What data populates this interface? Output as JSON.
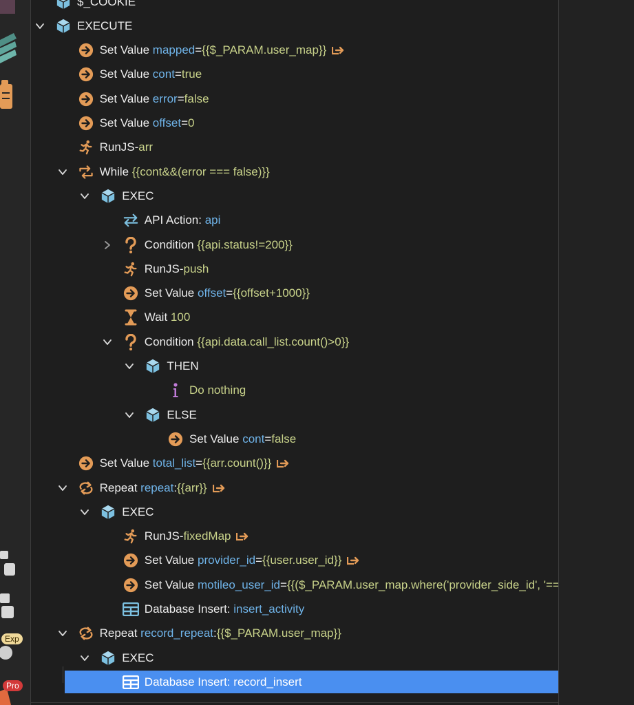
{
  "sidebar": {
    "badge_exp": "Exp",
    "badge_pro": "Pro"
  },
  "rows": [
    {
      "id": "cookie",
      "kw": "$_COOKIE"
    },
    {
      "id": "execute",
      "kw": "EXECUTE"
    },
    {
      "id": "sv-mapped",
      "kw": "Set Value",
      "var": "mapped",
      "sep": " = ",
      "val": "{{$_PARAM.user_map}}"
    },
    {
      "id": "sv-cont",
      "kw": "Set Value",
      "var": "cont",
      "sep": " = ",
      "val": "true"
    },
    {
      "id": "sv-error",
      "kw": "Set Value",
      "var": "error",
      "sep": " = ",
      "val": "false"
    },
    {
      "id": "sv-offset",
      "kw": "Set Value",
      "var": "offset",
      "sep": " = ",
      "val": "0"
    },
    {
      "id": "runjs-arr",
      "kw": "RunJS",
      "sep": " - ",
      "val": "arr"
    },
    {
      "id": "while",
      "kw": "While",
      "val": "{{cont&&(error === false)}}"
    },
    {
      "id": "exec-1",
      "kw": "EXEC"
    },
    {
      "id": "api",
      "kw": "API Action:",
      "var": "api"
    },
    {
      "id": "cond-1",
      "kw": "Condition",
      "val": "{{api.status!=200}}"
    },
    {
      "id": "runjs-push",
      "kw": "RunJS",
      "sep": " - ",
      "val": "push"
    },
    {
      "id": "sv-offset2",
      "kw": "Set Value",
      "var": "offset",
      "sep": " = ",
      "val": "{{offset+1000}}"
    },
    {
      "id": "wait",
      "kw": "Wait",
      "val": "100"
    },
    {
      "id": "cond-2",
      "kw": "Condition",
      "val": "{{api.data.call_list.count()>0}}"
    },
    {
      "id": "then",
      "kw": "THEN"
    },
    {
      "id": "do-nothing",
      "val": "Do nothing"
    },
    {
      "id": "else",
      "kw": "ELSE"
    },
    {
      "id": "sv-cont2",
      "kw": "Set Value",
      "var": "cont",
      "sep": " = ",
      "val": "false"
    },
    {
      "id": "sv-total",
      "kw": "Set Value",
      "var": "total_list",
      "sep": " = ",
      "val": "{{arr.count()}}"
    },
    {
      "id": "repeat-1",
      "kw": "Repeat",
      "var": "repeat",
      "sep": ": ",
      "val": "{{arr}}"
    },
    {
      "id": "exec-2",
      "kw": "EXEC"
    },
    {
      "id": "runjs-fixed",
      "kw": "RunJS",
      "sep": " - ",
      "val": "fixedMap"
    },
    {
      "id": "sv-provider",
      "kw": "Set Value",
      "var": "provider_id",
      "sep": " = ",
      "val": "{{user.user_id}}"
    },
    {
      "id": "sv-motileo",
      "kw": "Set Value",
      "var": "motileo_user_id",
      "sep": " = ",
      "val": "{{($_PARAM.user_map.where('provider_side_id', '=='"
    },
    {
      "id": "db-activity",
      "kw": "Database Insert:",
      "var": "insert_activity"
    },
    {
      "id": "repeat-2",
      "kw": "Repeat",
      "var": "record_repeat",
      "sep": ": ",
      "val": "{{$_PARAM.user_map}}"
    },
    {
      "id": "exec-3",
      "kw": "EXEC"
    },
    {
      "id": "db-record",
      "kw": "Database Insert:",
      "var": "record_insert"
    }
  ]
}
